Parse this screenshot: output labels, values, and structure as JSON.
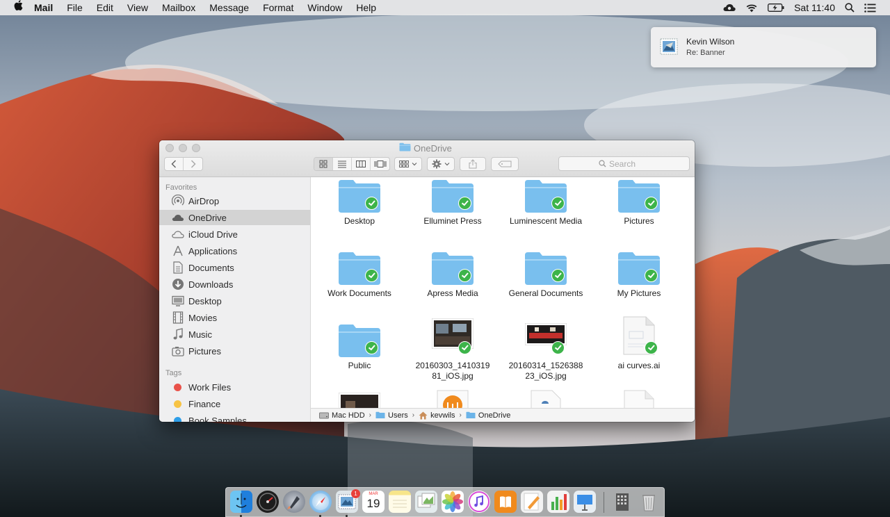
{
  "menubar": {
    "apple_icon": "apple-logo",
    "app_name": "Mail",
    "menus": [
      "File",
      "Edit",
      "View",
      "Mailbox",
      "Message",
      "Format",
      "Window",
      "Help"
    ],
    "clock": "Sat 11:40",
    "status_icons": [
      "creative-cloud-icon",
      "wifi-icon",
      "battery-charging-icon",
      "spotlight-search-icon",
      "notification-center-icon"
    ]
  },
  "notification": {
    "app_icon": "mail-stamp-icon",
    "title": "Kevin Wilson",
    "body": "Re: Banner"
  },
  "finder": {
    "title": "OneDrive",
    "search_placeholder": "Search",
    "view_mode": "icon",
    "sidebar": {
      "favorites_heading": "Favorites",
      "favorites": [
        {
          "label": "AirDrop",
          "icon": "airdrop-icon"
        },
        {
          "label": "OneDrive",
          "icon": "cloud-icon",
          "selected": true
        },
        {
          "label": "iCloud Drive",
          "icon": "icloud-icon"
        },
        {
          "label": "Applications",
          "icon": "applications-icon"
        },
        {
          "label": "Documents",
          "icon": "documents-icon"
        },
        {
          "label": "Downloads",
          "icon": "downloads-icon"
        },
        {
          "label": "Desktop",
          "icon": "desktop-icon"
        },
        {
          "label": "Movies",
          "icon": "movies-icon"
        },
        {
          "label": "Music",
          "icon": "music-icon"
        },
        {
          "label": "Pictures",
          "icon": "pictures-icon"
        }
      ],
      "tags_heading": "Tags",
      "tags": [
        {
          "label": "Work Files",
          "color": "#e9524a"
        },
        {
          "label": "Finance",
          "color": "#f7c344"
        },
        {
          "label": "Book Samples",
          "color": "#2e9ee8"
        }
      ]
    },
    "items": [
      {
        "name": "Desktop",
        "kind": "folder",
        "synced": true
      },
      {
        "name": "Elluminet Press",
        "kind": "folder",
        "synced": true
      },
      {
        "name": "Luminescent Media",
        "kind": "folder",
        "synced": true
      },
      {
        "name": "Pictures",
        "kind": "folder",
        "synced": true
      },
      {
        "name": "Work Documents",
        "kind": "folder",
        "synced": true
      },
      {
        "name": "Apress Media",
        "kind": "folder",
        "synced": true
      },
      {
        "name": "General Documents",
        "kind": "folder",
        "synced": true
      },
      {
        "name": "My Pictures",
        "kind": "folder",
        "synced": true
      },
      {
        "name": "Public",
        "kind": "folder",
        "synced": true
      },
      {
        "name": "20160303_141031981_iOS.jpg",
        "line1": "20160303_1410319",
        "line2": "81_iOS.jpg",
        "kind": "photo",
        "synced": true
      },
      {
        "name": "20160314_152638823_iOS.jpg",
        "line1": "20160314_1526388",
        "line2": "23_iOS.jpg",
        "kind": "photo",
        "synced": true
      },
      {
        "name": "ai curves.ai",
        "kind": "document",
        "synced": true
      }
    ],
    "path": [
      {
        "label": "Mac HDD",
        "icon": "hard-drive-icon"
      },
      {
        "label": "Users",
        "icon": "folder-icon"
      },
      {
        "label": "kevwils",
        "icon": "home-icon"
      },
      {
        "label": "OneDrive",
        "icon": "folder-icon"
      }
    ]
  },
  "dock": {
    "apps": [
      "Finder",
      "Dashboard",
      "Launchpad",
      "Safari",
      "Mail",
      "Calendar",
      "Notes",
      "Preview",
      "Photos",
      "iTunes",
      "iBooks",
      "Pages",
      "Numbers",
      "Keynote",
      "Utilities",
      "Trash"
    ],
    "mail_badge": "1",
    "calendar_month": "MAR",
    "calendar_day": "19"
  }
}
